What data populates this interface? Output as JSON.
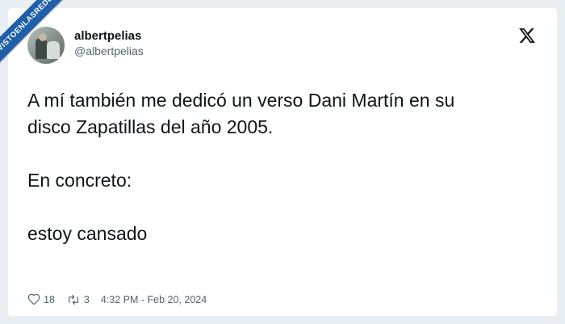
{
  "watermark": {
    "text": "VISTOENLASREDES"
  },
  "tweet": {
    "display_name": "albertpelias",
    "handle": "@albertpelias",
    "body_lines": [
      "A mí también me dedicó un verso Dani Martín en su",
      "disco Zapatillas del año 2005.",
      "En concreto:",
      "estoy cansado"
    ],
    "likes": "18",
    "retweets": "3",
    "timestamp": "4:32 PM - Feb 20, 2024"
  },
  "icons": {
    "logo": "x-logo-icon",
    "like": "heart-icon",
    "retweet": "retweet-icon"
  },
  "colors": {
    "text": "#0f1419",
    "muted": "#536471",
    "background": "#e9eef3",
    "watermark": "#1f5fa8"
  }
}
